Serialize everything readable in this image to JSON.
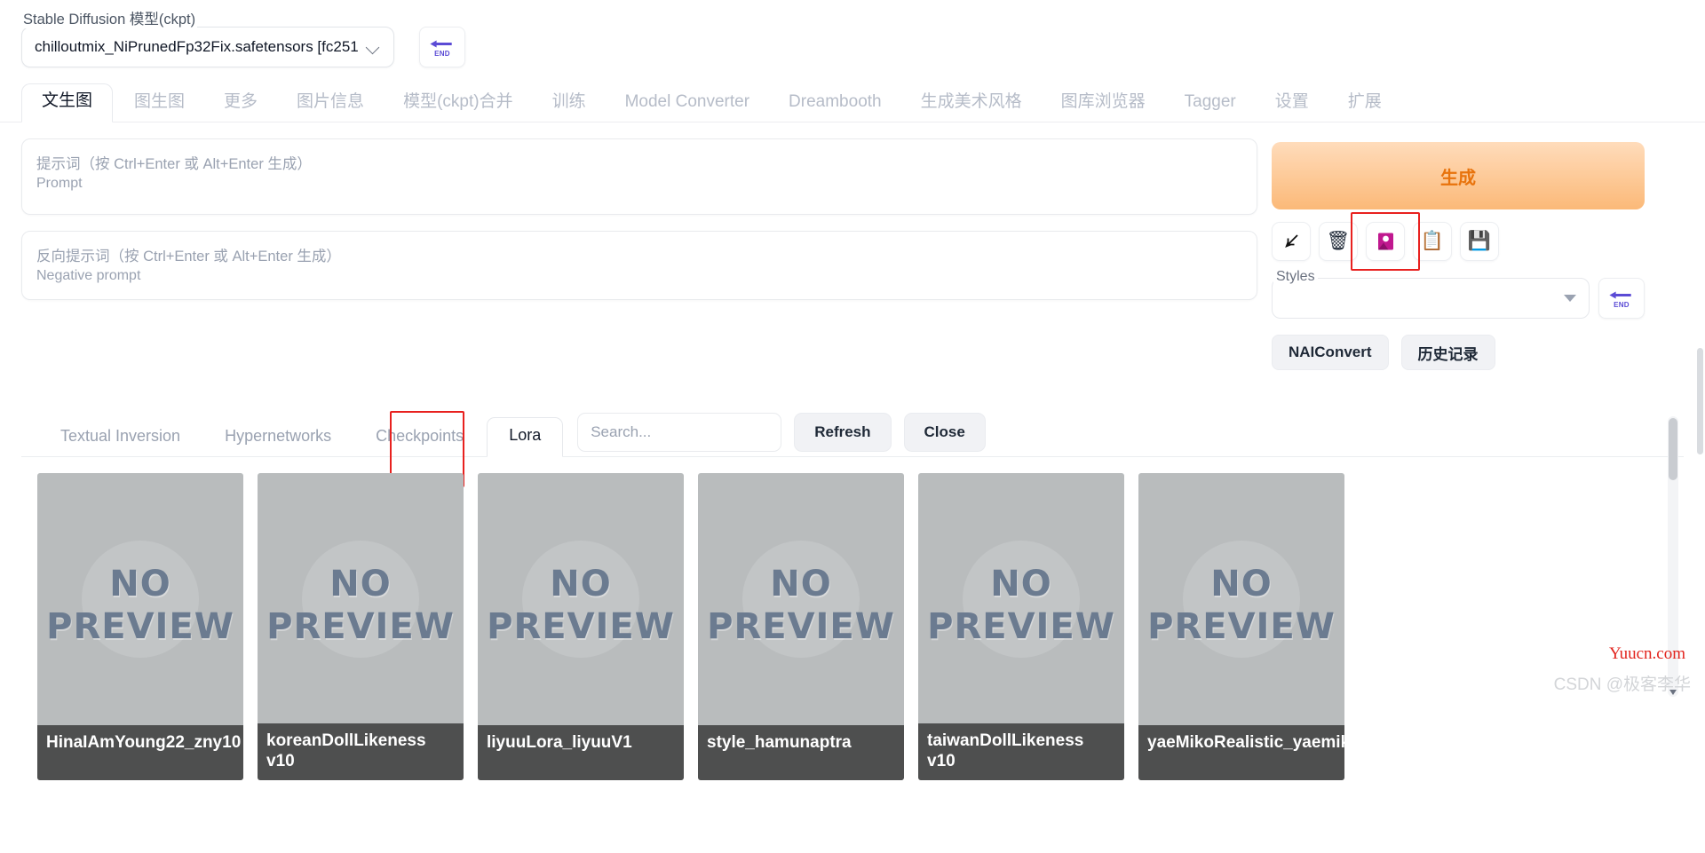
{
  "model_bar": {
    "label": "Stable Diffusion 模型(ckpt)",
    "value": "chilloutmix_NiPrunedFp32Fix.safetensors [fc251",
    "chevron_icon": "chevron-down-icon",
    "end_button_label": "END"
  },
  "main_tabs": [
    {
      "label": "文生图",
      "active": true
    },
    {
      "label": "图生图",
      "active": false
    },
    {
      "label": "更多",
      "active": false
    },
    {
      "label": "图片信息",
      "active": false
    },
    {
      "label": "模型(ckpt)合并",
      "active": false
    },
    {
      "label": "训练",
      "active": false
    },
    {
      "label": "Model Converter",
      "active": false
    },
    {
      "label": "Dreambooth",
      "active": false
    },
    {
      "label": "生成美术风格",
      "active": false
    },
    {
      "label": "图库浏览器",
      "active": false
    },
    {
      "label": "Tagger",
      "active": false
    },
    {
      "label": "设置",
      "active": false
    },
    {
      "label": "扩展",
      "active": false
    }
  ],
  "prompt": {
    "placeholder_zh": "提示词（按 Ctrl+Enter 或 Alt+Enter 生成）",
    "placeholder_en": "Prompt",
    "value": ""
  },
  "negative_prompt": {
    "placeholder_zh": "反向提示词（按 Ctrl+Enter 或 Alt+Enter 生成）",
    "placeholder_en": "Negative prompt",
    "value": ""
  },
  "right_panel": {
    "generate_label": "生成",
    "generate_color": "#e8730c",
    "icons": [
      {
        "name": "arrow-down-left-icon",
        "glyph": "↙",
        "highlighted": false
      },
      {
        "name": "trash-icon",
        "glyph": "🗑",
        "highlighted": false
      },
      {
        "name": "extra-networks-icon",
        "glyph": "🎴",
        "highlighted": true
      },
      {
        "name": "clipboard-icon",
        "glyph": "📋",
        "highlighted": false
      },
      {
        "name": "save-floppy-icon",
        "glyph": "💾",
        "highlighted": false
      }
    ],
    "styles_label": "Styles",
    "styles_value": "",
    "styles_end_label": "END",
    "naiconvert_label": "NAIConvert",
    "history_label": "历史记录",
    "highlight_color": "#e8211f"
  },
  "extra_networks": {
    "tabs": [
      {
        "label": "Textual Inversion",
        "active": false
      },
      {
        "label": "Hypernetworks",
        "active": false
      },
      {
        "label": "Checkpoints",
        "active": false
      },
      {
        "label": "Lora",
        "active": true
      }
    ],
    "search_placeholder": "Search...",
    "search_value": "",
    "refresh_label": "Refresh",
    "close_label": "Close",
    "cards": [
      {
        "name": "HinaIAmYoung22_zny10",
        "preview": "NO PREVIEW"
      },
      {
        "name": "koreanDollLikeness v10",
        "preview": "NO PREVIEW"
      },
      {
        "name": "liyuuLora_liyuuV1",
        "preview": "NO PREVIEW"
      },
      {
        "name": "style_hamunaptra",
        "preview": "NO PREVIEW"
      },
      {
        "name": "taiwanDollLikeness v10",
        "preview": "NO PREVIEW"
      },
      {
        "name": "yaeMikoRealistic_yaemikoMixed",
        "preview": "NO PREVIEW"
      }
    ],
    "preview_line1": "NO",
    "preview_line2": "PREVIEW"
  },
  "watermarks": {
    "primary": "Yuucn.com",
    "secondary": "CSDN @极客李华"
  }
}
